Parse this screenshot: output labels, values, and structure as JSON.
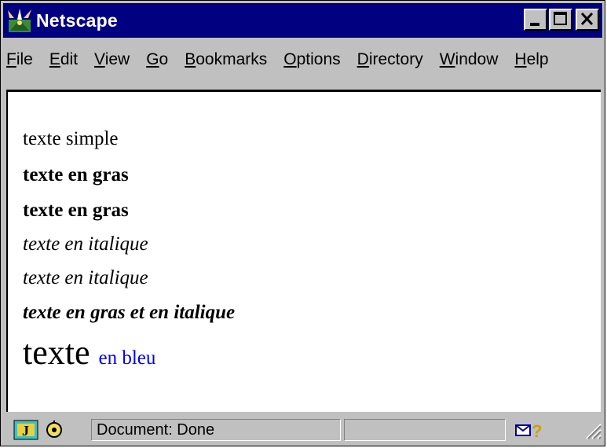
{
  "window": {
    "title": "Netscape"
  },
  "menu": [
    {
      "pre": "",
      "key": "F",
      "post": "ile"
    },
    {
      "pre": "",
      "key": "E",
      "post": "dit"
    },
    {
      "pre": "",
      "key": "V",
      "post": "iew"
    },
    {
      "pre": "",
      "key": "G",
      "post": "o"
    },
    {
      "pre": "",
      "key": "B",
      "post": "ookmarks"
    },
    {
      "pre": "",
      "key": "O",
      "post": "ptions"
    },
    {
      "pre": "",
      "key": "D",
      "post": "irectory"
    },
    {
      "pre": "",
      "key": "W",
      "post": "indow"
    },
    {
      "pre": "",
      "key": "H",
      "post": "elp"
    }
  ],
  "content": {
    "simple": "texte simple",
    "bold1": "texte en gras",
    "bold2": "texte en gras",
    "italic1": "texte en italique",
    "italic2": "texte en italique",
    "bold_italic": "texte en gras et en italique",
    "large": "texte",
    "blue": "en bleu",
    "blue_color": "#0000ff"
  },
  "status": {
    "text": "Document: Done"
  },
  "icons": [
    "netscape-logo-icon",
    "minimize-icon",
    "maximize-icon",
    "close-icon",
    "security-key-icon",
    "component-icon",
    "mail-icon",
    "help-icon",
    "resize-grip-icon"
  ],
  "colors": {
    "titlebar": "#000080",
    "chrome": "#c0c0c0",
    "content_bg": "#ffffff"
  }
}
